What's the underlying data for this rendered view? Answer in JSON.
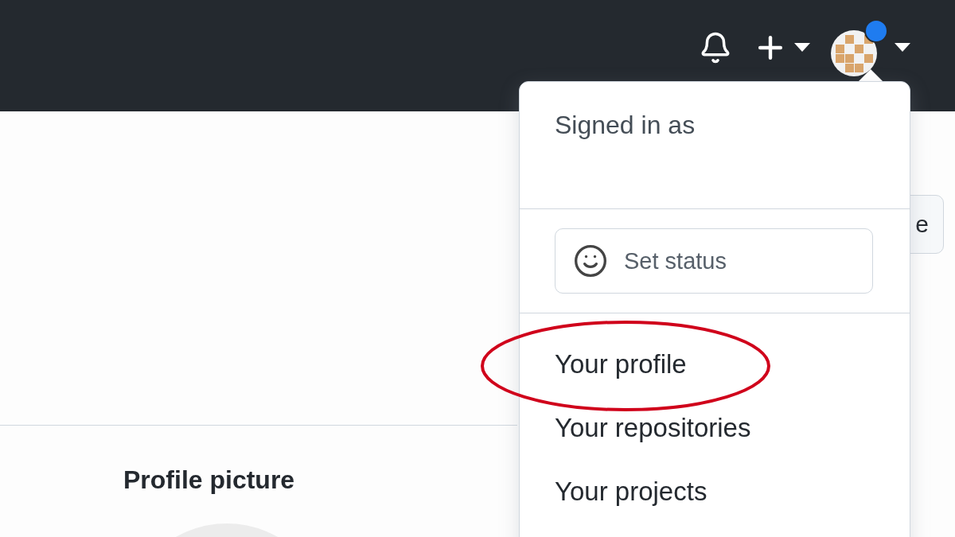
{
  "header": {
    "avatar": {
      "unread": true
    }
  },
  "page": {
    "button_fragment": "e",
    "section_title": "Profile picture"
  },
  "menu": {
    "signed_in_label": "Signed in as",
    "status_button": "Set status",
    "items": [
      {
        "label": "Your profile",
        "highlighted": true
      },
      {
        "label": "Your repositories",
        "highlighted": false
      },
      {
        "label": "Your projects",
        "highlighted": false
      }
    ]
  }
}
